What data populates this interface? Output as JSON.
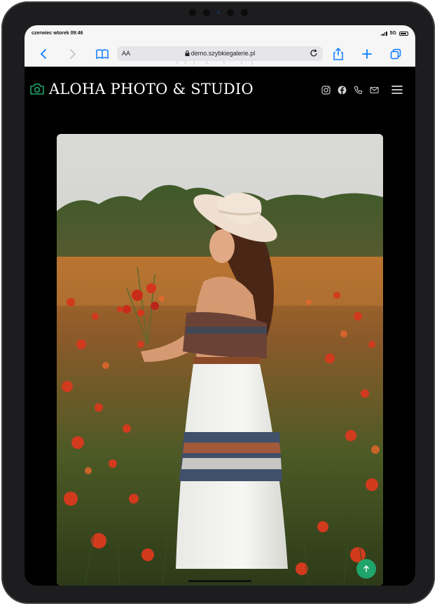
{
  "status_bar": {
    "time": "czerwiec wtorek 09:46",
    "network": "5G"
  },
  "browser": {
    "text_size_label": "AA",
    "url": "demo.szybkiegalerie.pl",
    "icons": [
      "back-icon",
      "forward-icon",
      "bookmarks-icon",
      "lock-icon",
      "reload-icon",
      "share-icon",
      "new-tab-icon",
      "tabs-icon"
    ],
    "accent": "#0a7aff"
  },
  "site": {
    "brand": "ALOHA PHOTO & STUDIO",
    "brand_icon": "camera-icon",
    "brand_icon_color": "#1fa56b",
    "social_icons": [
      "instagram-icon",
      "facebook-icon",
      "phone-icon",
      "email-icon"
    ],
    "menu_icon": "hamburger-menu-icon",
    "hero_image": "woman-in-poppy-field-photo",
    "scroll_top_icon": "arrow-up-icon",
    "scroll_top_color": "#1fa56b"
  }
}
